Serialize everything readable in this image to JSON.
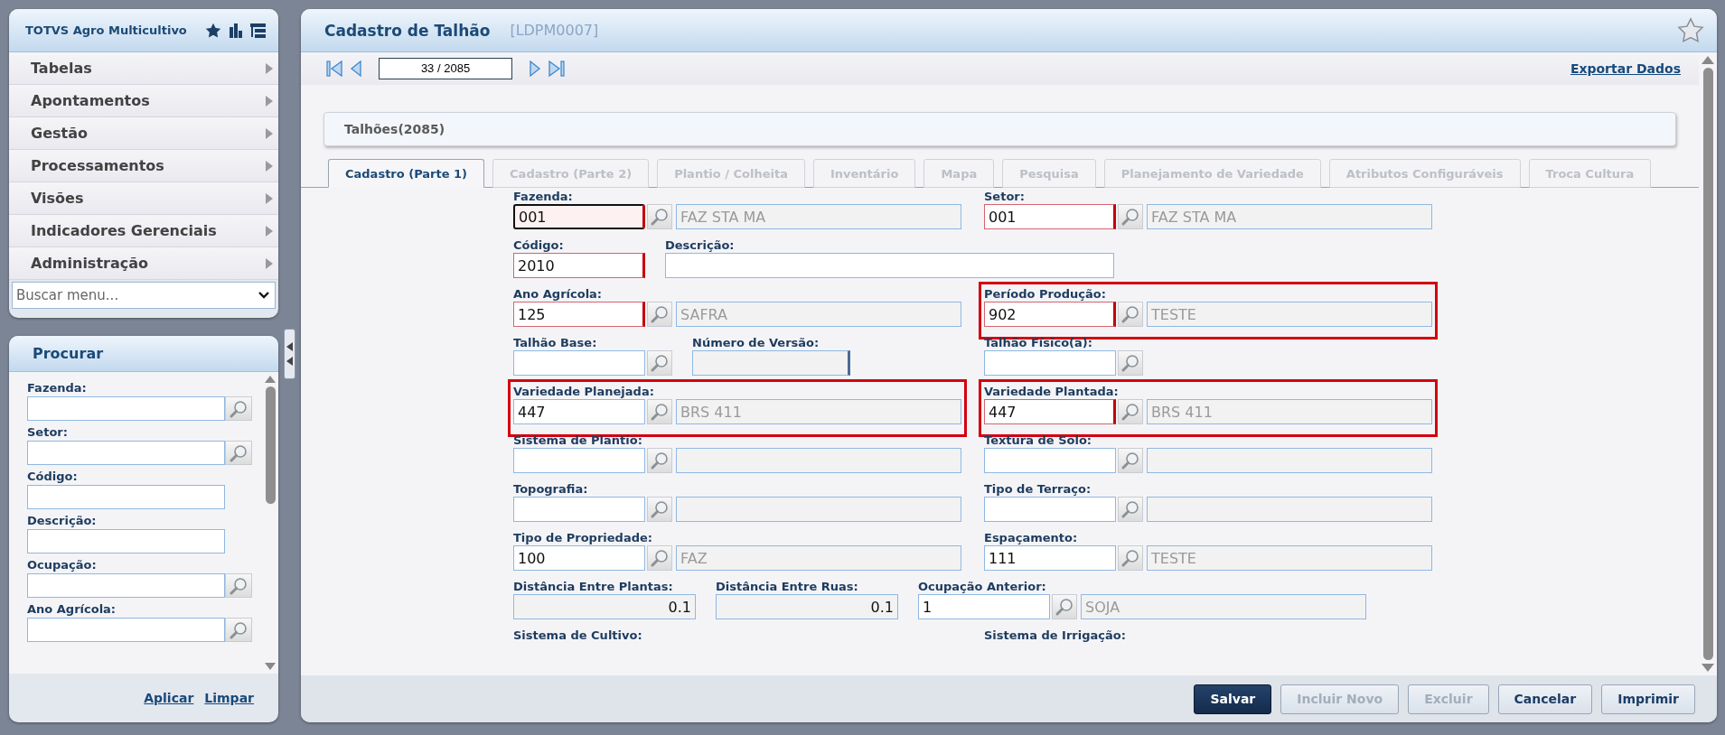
{
  "sidebar": {
    "title": "TOTVS Agro Multicultivo",
    "menu": [
      {
        "label": "Tabelas"
      },
      {
        "label": "Apontamentos"
      },
      {
        "label": "Gestão"
      },
      {
        "label": "Processamentos"
      },
      {
        "label": "Visões"
      },
      {
        "label": "Indicadores Gerenciais"
      },
      {
        "label": "Administração"
      }
    ],
    "menu_search": {
      "placeholder": "Buscar menu..."
    }
  },
  "search_panel": {
    "title": "Procurar",
    "fields": [
      {
        "label": "Fazenda:",
        "kind": "lookup"
      },
      {
        "label": "Setor:",
        "kind": "lookup"
      },
      {
        "label": "Código:",
        "kind": "text"
      },
      {
        "label": "Descrição:",
        "kind": "text"
      },
      {
        "label": "Ocupação:",
        "kind": "lookup"
      },
      {
        "label": "Ano Agrícola:",
        "kind": "lookup"
      }
    ],
    "actions": [
      "Aplicar",
      "Limpar"
    ]
  },
  "page": {
    "title": "Cadastro de Talhão",
    "code": "[LDPM0007]",
    "record_position": "33 / 2085",
    "export_link": "Exportar Dados",
    "group_title": "Talhões(2085)",
    "tabs": [
      {
        "label": "Cadastro (Parte 1)",
        "selected": true,
        "disabled": false
      },
      {
        "label": "Cadastro (Parte 2)",
        "selected": false,
        "disabled": true
      },
      {
        "label": "Plantio / Colheita",
        "selected": false,
        "disabled": true
      },
      {
        "label": "Inventário",
        "selected": false,
        "disabled": true
      },
      {
        "label": "Mapa",
        "selected": false,
        "disabled": true
      },
      {
        "label": "Pesquisa",
        "selected": false,
        "disabled": true
      },
      {
        "label": "Planejamento de Variedade",
        "selected": false,
        "disabled": true
      },
      {
        "label": "Atributos Configuráveis",
        "selected": false,
        "disabled": true
      },
      {
        "label": "Troca Cultura",
        "selected": false,
        "disabled": true
      }
    ],
    "form_rows": [
      {
        "left": [
          {
            "label": "Fazenda:",
            "kind": "lookup",
            "value": "001",
            "description": "FAZ STA MA",
            "required": true,
            "focused": true,
            "highlighted": false
          }
        ],
        "right": [
          {
            "label": "Setor:",
            "kind": "lookup",
            "value": "001",
            "description": "FAZ STA MA",
            "required": true,
            "focused": false,
            "highlighted": false
          }
        ]
      },
      {
        "left": [
          {
            "label": "Código:",
            "kind": "code",
            "value": "2010",
            "required": true,
            "focused": false,
            "highlighted": false
          },
          {
            "label": "Descrição:",
            "kind": "wide",
            "required": false,
            "focused": false,
            "highlighted": false
          }
        ],
        "right": []
      },
      {
        "left": [
          {
            "label": "Ano Agrícola:",
            "kind": "lookup",
            "value": "125",
            "description": "SAFRA",
            "required": true,
            "focused": false,
            "highlighted": false
          }
        ],
        "right": [
          {
            "label": "Período Produção:",
            "kind": "lookup",
            "value": "902",
            "description": "TESTE",
            "required": true,
            "focused": false,
            "highlighted": true
          }
        ]
      },
      {
        "left": [
          {
            "label": "Talhão Base:",
            "kind": "search",
            "required": false,
            "focused": false,
            "highlighted": false
          },
          {
            "label": "Número de Versão:",
            "kind": "readonly",
            "required": false,
            "focused": false,
            "highlighted": false
          }
        ],
        "right": [
          {
            "label": "Talhão Físico(a):",
            "kind": "search",
            "required": false,
            "focused": false,
            "highlighted": false
          }
        ]
      },
      {
        "left": [
          {
            "label": "Variedade Planejada:",
            "kind": "lookup",
            "value": "447",
            "description": "BRS 411",
            "required": false,
            "focused": false,
            "highlighted": true
          }
        ],
        "right": [
          {
            "label": "Variedade Plantada:",
            "kind": "lookup",
            "value": "447",
            "description": "BRS 411",
            "required": true,
            "focused": false,
            "highlighted": true
          }
        ]
      },
      {
        "left": [
          {
            "label": "Sistema de Plantio:",
            "kind": "lookup",
            "required": false,
            "focused": false,
            "highlighted": false
          }
        ],
        "right": [
          {
            "label": "Textura de Solo:",
            "kind": "lookup",
            "required": false,
            "focused": false,
            "highlighted": false
          }
        ]
      },
      {
        "left": [
          {
            "label": "Topografia:",
            "kind": "lookup",
            "required": false,
            "focused": false,
            "highlighted": false
          }
        ],
        "right": [
          {
            "label": "Tipo de Terraço:",
            "kind": "lookup",
            "required": false,
            "focused": false,
            "highlighted": false
          }
        ]
      },
      {
        "left": [
          {
            "label": "Tipo de Propriedade:",
            "kind": "lookup",
            "value": "100",
            "description": "FAZ",
            "required": false,
            "focused": false,
            "highlighted": false
          }
        ],
        "right": [
          {
            "label": "Espaçamento:",
            "kind": "lookup",
            "value": "111",
            "description": "TESTE",
            "required": false,
            "focused": false,
            "highlighted": false
          }
        ]
      },
      {
        "left": [
          {
            "label": "Distância Entre Plantas:",
            "kind": "number",
            "value": "0.1",
            "required": false,
            "focused": false,
            "highlighted": false
          },
          {
            "label": "Distância Entre Ruas:",
            "kind": "number",
            "value": "0.1",
            "required": false,
            "focused": false,
            "highlighted": false
          },
          {
            "label": "Ocupação Anterior:",
            "kind": "lookup",
            "value": "1",
            "description": "SOJA",
            "required": false,
            "focused": false,
            "highlighted": false
          }
        ],
        "right": []
      },
      {
        "left": [
          {
            "label": "Sistema de Cultivo:",
            "kind": "caption"
          }
        ],
        "right": [
          {
            "label": "Sistema de Irrigação:",
            "kind": "caption"
          }
        ]
      }
    ],
    "buttons": [
      {
        "label": "Salvar",
        "primary": true,
        "disabled": false
      },
      {
        "label": "Incluir Novo",
        "primary": false,
        "disabled": true
      },
      {
        "label": "Excluir",
        "primary": false,
        "disabled": true
      },
      {
        "label": "Cancelar",
        "primary": false,
        "disabled": false
      },
      {
        "label": "Imprimir",
        "primary": false,
        "disabled": false
      }
    ]
  }
}
